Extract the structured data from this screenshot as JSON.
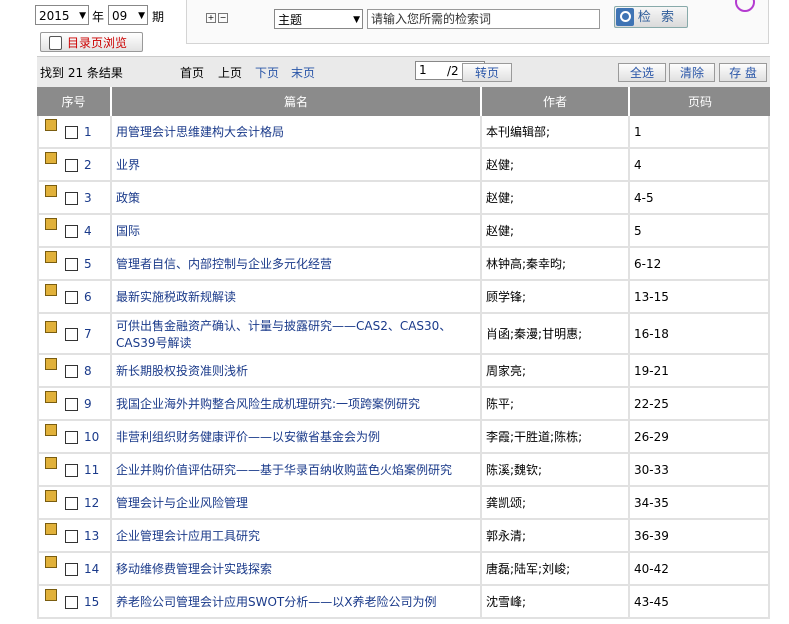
{
  "filters": {
    "year": "2015",
    "year_unit": "年",
    "issue": "09",
    "issue_unit": "期"
  },
  "search": {
    "field": "主题",
    "placeholder": "请输入您所需的检索词",
    "button": "检 索"
  },
  "catalog_button": "目录页浏览",
  "toolbar": {
    "result_text": "找到 21 条结果",
    "first": "首页",
    "prev": "上页",
    "next": "下页",
    "last": "末页",
    "page_value": "1",
    "page_total": "/2",
    "go": "转页",
    "select_all": "全选",
    "clear": "清除",
    "save": "存 盘"
  },
  "table": {
    "headers": [
      "序号",
      "篇名",
      "作者",
      "页码"
    ],
    "rows": [
      {
        "no": "1",
        "title": "用管理会计思维建构大会计格局",
        "author": "本刊编辑部;",
        "pages": "1"
      },
      {
        "no": "2",
        "title": "业界",
        "author": "赵健;",
        "pages": "4"
      },
      {
        "no": "3",
        "title": "政策",
        "author": "赵健;",
        "pages": "4-5"
      },
      {
        "no": "4",
        "title": "国际",
        "author": "赵健;",
        "pages": "5"
      },
      {
        "no": "5",
        "title": "管理者自信、内部控制与企业多元化经营",
        "author": "林钟高;秦幸昀;",
        "pages": "6-12"
      },
      {
        "no": "6",
        "title": "最新实施税政新规解读",
        "author": "顾学锋;",
        "pages": "13-15"
      },
      {
        "no": "7",
        "title": "可供出售金融资产确认、计量与披露研究——CAS2、CAS30、CAS39号解读",
        "author": "肖函;秦漫;甘明惠;",
        "pages": "16-18"
      },
      {
        "no": "8",
        "title": "新长期股权投资准则浅析",
        "author": "周家亮;",
        "pages": "19-21"
      },
      {
        "no": "9",
        "title": "我国企业海外并购整合风险生成机理研究:一项跨案例研究",
        "author": "陈平;",
        "pages": "22-25"
      },
      {
        "no": "10",
        "title": "非营利组织财务健康评价——以安徽省基金会为例",
        "author": "李霞;干胜道;陈栋;",
        "pages": "26-29"
      },
      {
        "no": "11",
        "title": "企业并购价值评估研究——基于华录百纳收购蓝色火焰案例研究",
        "author": "陈溪;魏钦;",
        "pages": "30-33"
      },
      {
        "no": "12",
        "title": "管理会计与企业风险管理",
        "author": "龚凯颂;",
        "pages": "34-35"
      },
      {
        "no": "13",
        "title": "企业管理会计应用工具研究",
        "author": "郭永清;",
        "pages": "36-39"
      },
      {
        "no": "14",
        "title": "移动维修费管理会计实践探索",
        "author": "唐磊;陆军;刘峻;",
        "pages": "40-42"
      },
      {
        "no": "15",
        "title": "养老险公司管理会计应用SWOT分析——以X养老险公司为例",
        "author": "沈雪峰;",
        "pages": "43-45"
      }
    ]
  }
}
